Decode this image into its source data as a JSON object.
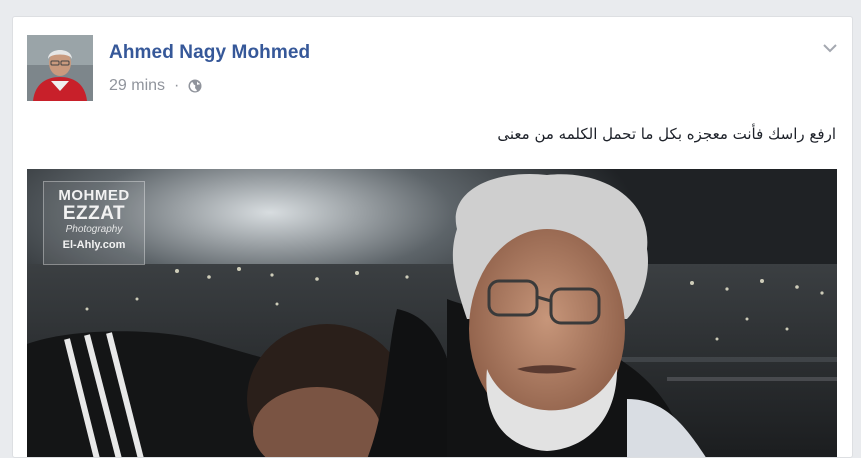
{
  "post": {
    "author_name": "Ahmed Nagy Mohmed",
    "timestamp": "29 mins",
    "separator": "·",
    "privacy_icon": "globe-icon",
    "menu_icon": "chevron-down-icon",
    "text": "ارفع راسك فأنت معجزه بكل ما تحمل الكلمه من معنى",
    "colors": {
      "author_link": "#365899",
      "meta": "#90949c",
      "body_text": "#1d2129",
      "page_bg": "#e9ebee"
    }
  },
  "photo": {
    "watermark": {
      "line1": "MOHMED",
      "line2": "EZZAT",
      "line3": "Photography",
      "line4": "El-Ahly.com"
    }
  }
}
